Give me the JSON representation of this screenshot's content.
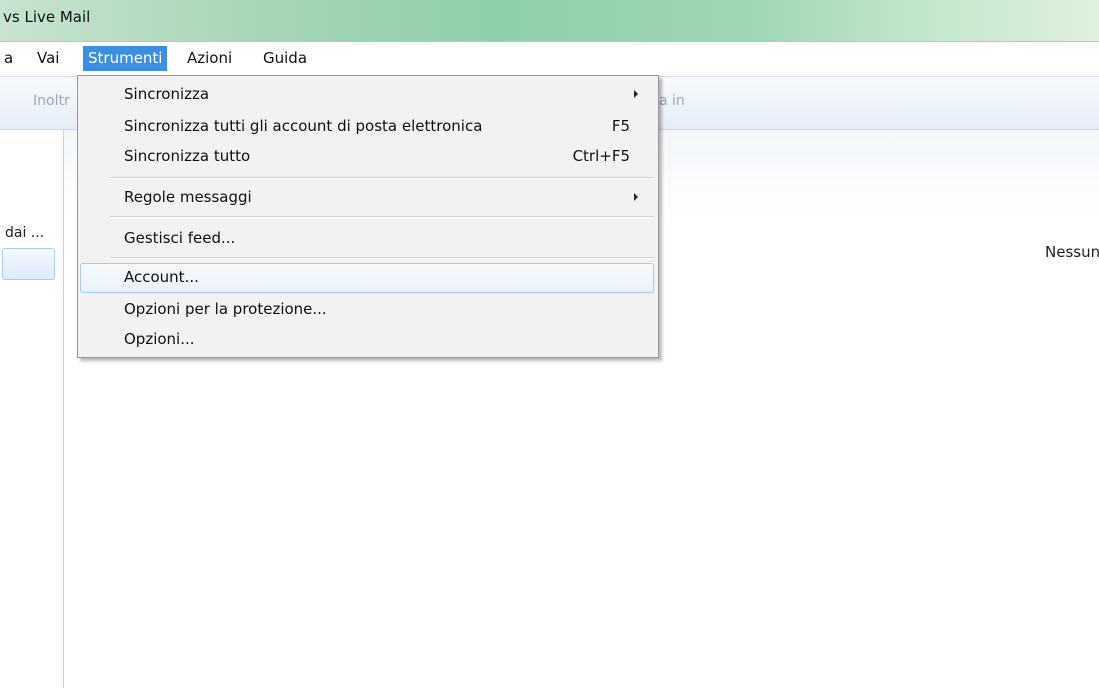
{
  "window": {
    "title": "vs Live Mail"
  },
  "menubar": {
    "items": [
      "a",
      "Vai",
      "Strumenti",
      "Azioni",
      "Guida"
    ],
    "active": "Strumenti"
  },
  "toolbar": {
    "left_text": "Inoltr",
    "right_text": "a in"
  },
  "left_pane": {
    "folder_label": "dai ..."
  },
  "main": {
    "empty_text": "Nessun e"
  },
  "dropdown": {
    "items": [
      {
        "label": "Sincronizza",
        "shortcut": "",
        "submenu": true
      },
      {
        "label": "Sincronizza tutti gli account di posta elettronica",
        "shortcut": "F5",
        "submenu": false
      },
      {
        "label": "Sincronizza tutto",
        "shortcut": "Ctrl+F5",
        "submenu": false
      },
      {
        "label": "Regole messaggi",
        "shortcut": "",
        "submenu": true
      },
      {
        "label": "Gestisci feed...",
        "shortcut": "",
        "submenu": false
      },
      {
        "label": "Account...",
        "shortcut": "",
        "submenu": false,
        "highlighted": true
      },
      {
        "label": "Opzioni per la protezione...",
        "shortcut": "",
        "submenu": false
      },
      {
        "label": "Opzioni...",
        "shortcut": "",
        "submenu": false
      }
    ]
  }
}
